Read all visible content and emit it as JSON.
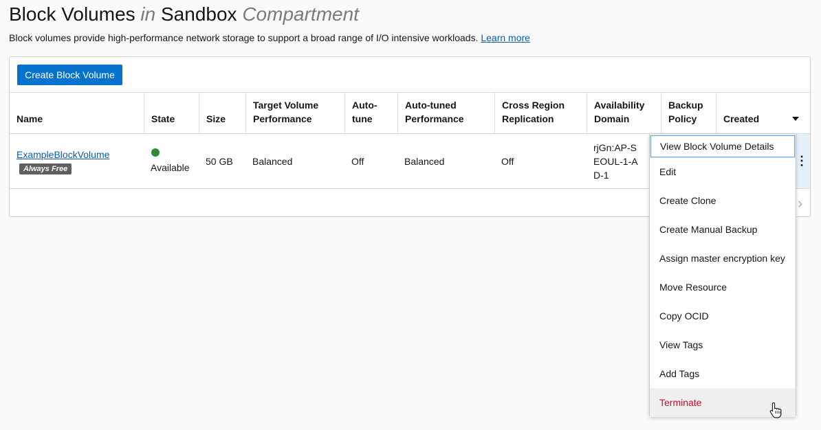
{
  "header": {
    "title_part1": "Block Volumes ",
    "title_in": "in",
    "title_part2": " Sandbox ",
    "title_compartment": "Compartment",
    "description": "Block volumes provide high-performance network storage to support a broad range of I/O intensive workloads.",
    "learn_more": "Learn more"
  },
  "toolbar": {
    "create_label": "Create Block Volume"
  },
  "table": {
    "columns": [
      {
        "label": "Name"
      },
      {
        "label": "State"
      },
      {
        "label": "Size"
      },
      {
        "label": "Target Volume Performance"
      },
      {
        "label": "Auto-tune"
      },
      {
        "label": "Auto-tuned Performance"
      },
      {
        "label": "Cross Region Replication"
      },
      {
        "label": "Availability Domain"
      },
      {
        "label": "Backup Policy"
      },
      {
        "label": "Created"
      }
    ],
    "rows": [
      {
        "name": "ExampleBlockVolume",
        "badge": "Always Free",
        "state": "Available",
        "size": "50 GB",
        "target_performance": "Balanced",
        "auto_tune": "Off",
        "auto_tuned_performance": "Balanced",
        "cross_region_replication": "Off",
        "availability_domain": "rjGn:AP-SEOUL-1-AD-1"
      }
    ],
    "actions_icon": "⋮",
    "next_page_icon": "›"
  },
  "context_menu": {
    "items": [
      {
        "label": "View Block Volume Details"
      },
      {
        "label": "Edit"
      },
      {
        "label": "Create Clone"
      },
      {
        "label": "Create Manual Backup"
      },
      {
        "label": "Assign master encryption key"
      },
      {
        "label": "Move Resource"
      },
      {
        "label": "Copy OCID"
      },
      {
        "label": "View Tags"
      },
      {
        "label": "Add Tags"
      },
      {
        "label": "Terminate"
      }
    ]
  },
  "colors": {
    "primary_button": "#0572ce",
    "link": "#0b5cad",
    "state_available": "#2d8a3a",
    "danger": "#c7101f"
  }
}
